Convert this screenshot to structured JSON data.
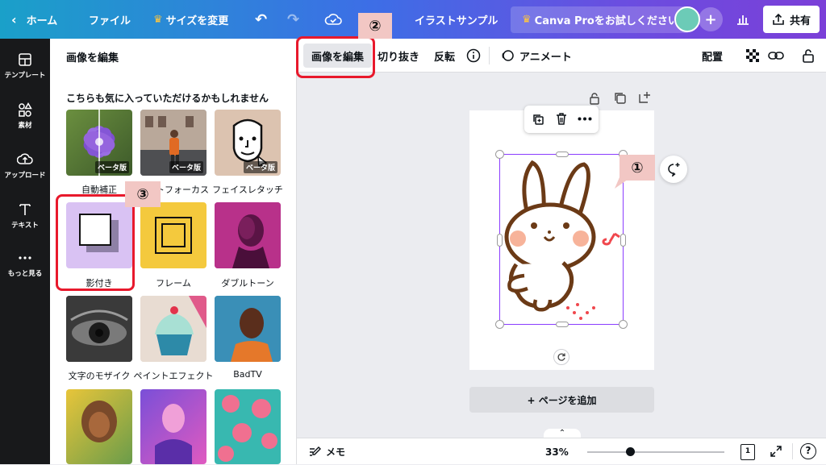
{
  "topbar": {
    "home": "ホーム",
    "file": "ファイル",
    "resize": "サイズを変更",
    "doc_title": "イラストサンプル",
    "pro_trial": "Canva Proをお試しください",
    "share": "共有"
  },
  "rail": {
    "items": [
      {
        "label": "テンプレート",
        "icon": "template-icon"
      },
      {
        "label": "素材",
        "icon": "elements-icon"
      },
      {
        "label": "アップロード",
        "icon": "upload-icon"
      },
      {
        "label": "テキスト",
        "icon": "text-icon"
      },
      {
        "label": "もっと見る",
        "icon": "more-icon"
      }
    ]
  },
  "panel": {
    "title": "画像を編集",
    "subtitle": "こちらも気に入っていただけるかもしれません",
    "beta": "ベータ版",
    "tiles": [
      {
        "label": "自動補正"
      },
      {
        "label": "オートフォーカス"
      },
      {
        "label": "フェイスレタッチ"
      },
      {
        "label": "影付き"
      },
      {
        "label": "フレーム"
      },
      {
        "label": "ダブルトーン"
      },
      {
        "label": "文字のモザイク"
      },
      {
        "label": "ペイントエフェクト"
      },
      {
        "label": "BadTV"
      }
    ]
  },
  "toolbar": {
    "edit_image": "画像を編集",
    "crop": "切り抜き",
    "flip": "反転",
    "animate": "アニメート",
    "position": "配置"
  },
  "canvas": {
    "add_page": "+ ページを追加"
  },
  "bottombar": {
    "notes": "メモ",
    "zoom": "33%",
    "zoom_fraction": 0.31,
    "page_count": "1"
  },
  "annotations": {
    "one": "①",
    "two": "②",
    "three": "③"
  },
  "colors": {
    "accent_purple": "#8b3dff",
    "annotation_red": "#e8192c",
    "annotation_tag": "#f2c7c4"
  }
}
